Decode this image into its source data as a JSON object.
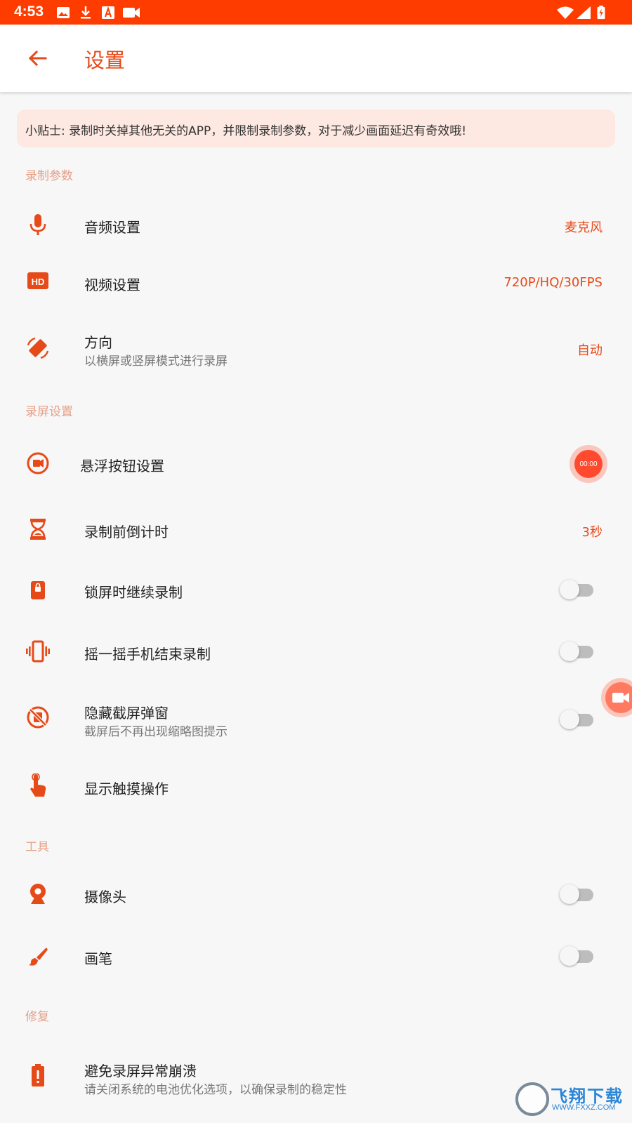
{
  "status_bar": {
    "time": "4:53",
    "color": "#ff3c00"
  },
  "app_bar": {
    "title": "设置",
    "accent": "#e64a19"
  },
  "tip": "小贴士: 录制时关掉其他无关的APP，并限制录制参数，对于减少画面延迟有奇效哦!",
  "sections": {
    "record_params": "录制参数",
    "screen_settings": "录屏设置",
    "tools": "工具",
    "repair": "修复"
  },
  "rows": {
    "audio": {
      "title": "音频设置",
      "value": "麦克风",
      "icon": "mic-icon"
    },
    "video": {
      "title": "视频设置",
      "value": "720P/HQ/30FPS",
      "icon": "hd-icon"
    },
    "orientation": {
      "title": "方向",
      "subtitle": "以横屏或竖屏模式进行录屏",
      "value": "自动",
      "icon": "screen-rotation-icon"
    },
    "float_button": {
      "title": "悬浮按钮设置",
      "preview": "00:00",
      "icon": "record-circle-icon"
    },
    "countdown": {
      "title": "录制前倒计时",
      "value": "3秒",
      "icon": "hourglass-icon"
    },
    "lock_screen": {
      "title": "锁屏时继续录制",
      "enabled": false,
      "icon": "lock-icon"
    },
    "shake": {
      "title": "摇一摇手机结束录制",
      "enabled": false,
      "icon": "vibrate-icon"
    },
    "hide_popup": {
      "title": "隐藏截屏弹窗",
      "subtitle": "截屏后不再出现缩略图提示",
      "enabled": false,
      "icon": "no-screenshot-icon"
    },
    "touches": {
      "title": "显示触摸操作",
      "icon": "touch-icon"
    },
    "camera": {
      "title": "摄像头",
      "enabled": false,
      "icon": "webcam-icon"
    },
    "brush": {
      "title": "画笔",
      "enabled": false,
      "icon": "brush-icon"
    },
    "battery": {
      "title": "避免录屏异常崩溃",
      "subtitle": "请关闭系统的电池优化选项，以确保录制的稳定性",
      "icon": "battery-alert-icon"
    }
  },
  "watermark": {
    "text": "飞翔下载",
    "url": "WWW.FXXZ.COM"
  }
}
